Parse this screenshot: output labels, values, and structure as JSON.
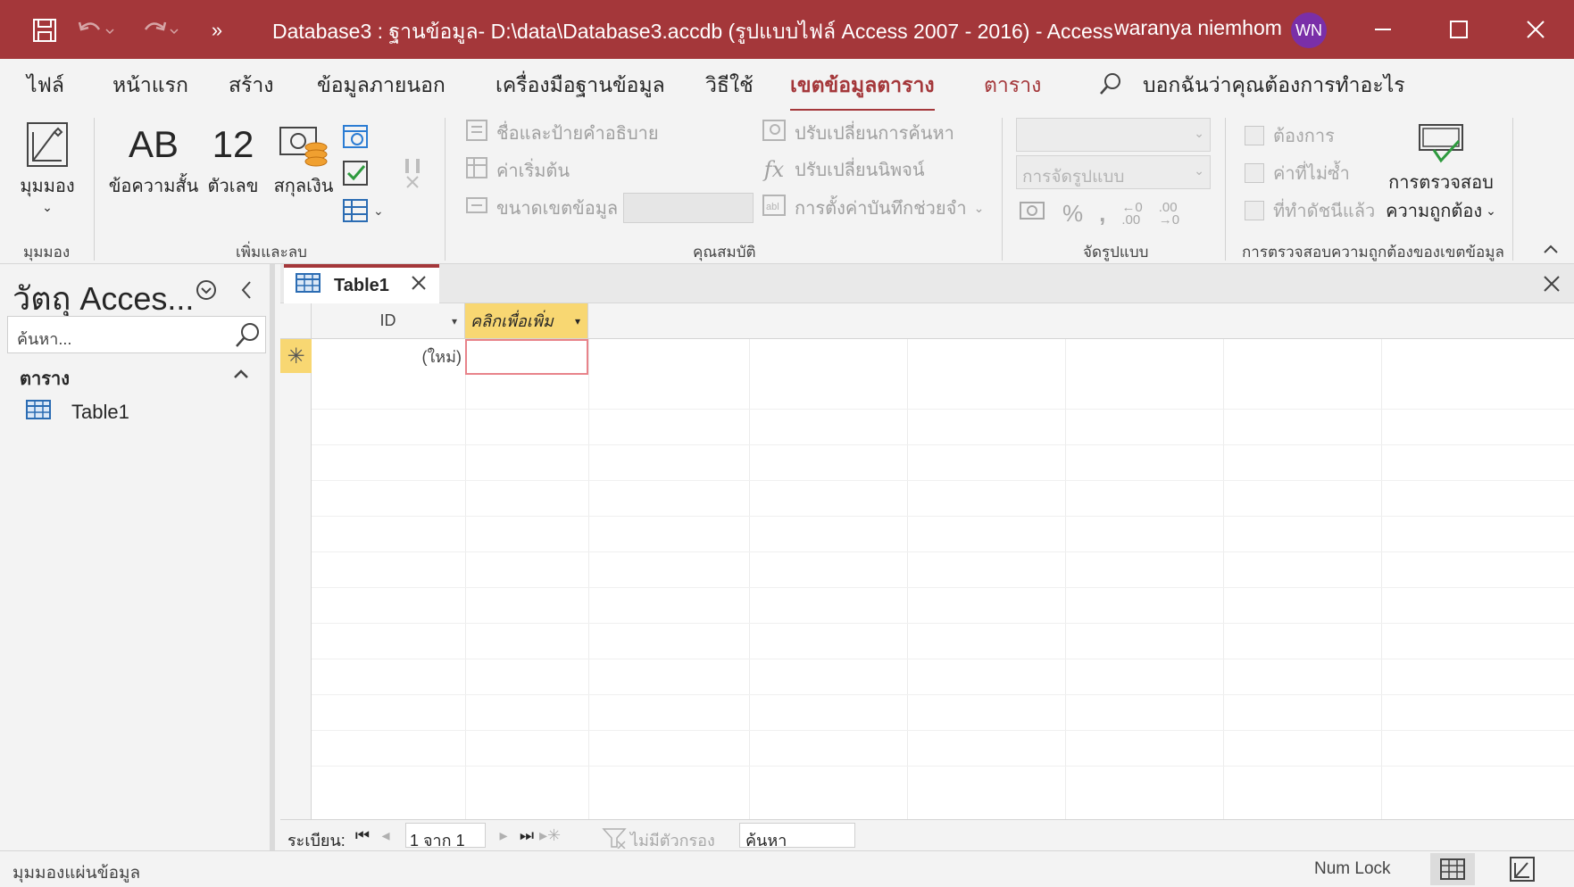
{
  "window": {
    "title": "Database3 : ฐานข้อมูล- D:\\data\\Database3.accdb (รูปแบบไฟล์ Access 2007 - 2016)  -  Access",
    "user_name": "waranya niemhom",
    "user_initials": "WN",
    "quick_access": [
      "save-icon",
      "undo-icon",
      "redo-icon",
      "more-icon"
    ],
    "accent_color": "#a4373a"
  },
  "tabs": [
    {
      "label": "ไฟล์"
    },
    {
      "label": "หน้าแรก"
    },
    {
      "label": "สร้าง"
    },
    {
      "label": "ข้อมูลภายนอก"
    },
    {
      "label": "เครื่องมือฐานข้อมูล"
    },
    {
      "label": "วิธีใช้"
    },
    {
      "label": "เขตข้อมูลตาราง",
      "active": true
    },
    {
      "label": "ตาราง"
    }
  ],
  "tell_me": "บอกฉันว่าคุณต้องการทำอะไร",
  "ribbon": {
    "views_group": {
      "label": "มุมมอง",
      "view_button": "มุมมอง"
    },
    "add_delete_group": {
      "label": "เพิ่มและลบ",
      "short_text": {
        "icon_text": "AB",
        "label": "ข้อความสั้น"
      },
      "number": {
        "icon_text": "12",
        "label": "ตัวเลข"
      },
      "currency": {
        "label": "สกุลเงิน"
      }
    },
    "properties_group": {
      "label": "คุณสมบัติ",
      "name_caption": "ชื่อและป้ายคำอธิบาย",
      "default_value": "ค่าเริ่มต้น",
      "field_size": "ขนาดเขตข้อมูล",
      "modify_lookups": "ปรับเปลี่ยนการค้นหา",
      "modify_expression": "ปรับเปลี่ยนนิพจน์",
      "memo_settings": "การตั้งค่าบันทึกช่วยจำ"
    },
    "formatting_group": {
      "label": "จัดรูปแบบ",
      "data_type_value": "",
      "format_placeholder": "การจัดรูปแบบ"
    },
    "validation_group": {
      "label": "การตรวจสอบความถูกต้องของเขตข้อมูล",
      "required": "ต้องการ",
      "unique": "ค่าที่ไม่ซ้ำ",
      "indexed": "ที่ทำดัชนีแล้ว",
      "validation_button_line1": "การตรวจสอบ",
      "validation_button_line2": "ความถูกต้อง"
    }
  },
  "nav_pane": {
    "title": "วัตถุ Acces...",
    "search_placeholder": "ค้นหา...",
    "group_label": "ตาราง",
    "items": [
      {
        "label": "Table1"
      }
    ]
  },
  "document": {
    "tab_label": "Table1",
    "columns": [
      {
        "label": "ID"
      },
      {
        "label": "คลิกเพื่อเพิ่ม"
      }
    ],
    "new_row_marker": "✳",
    "new_row_id": "(ใหม่)"
  },
  "record_nav": {
    "label": "ระเบียน:",
    "position": "1 จาก 1",
    "filter_text": "ไม่มีตัวกรอง",
    "search_text": "ค้นหา"
  },
  "status_bar": {
    "left_text": "มุมมองแผ่นข้อมูล",
    "num_lock": "Num Lock"
  }
}
